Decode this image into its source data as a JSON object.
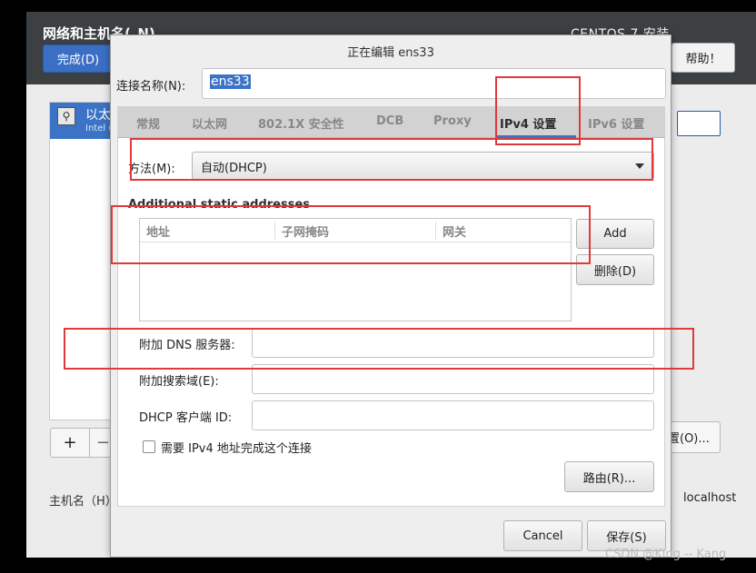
{
  "background": {
    "header_title": "网络和主机名(_N)",
    "header_right": "CENTOS 7 安装",
    "done_button": "完成(D)",
    "help_button": "帮助！",
    "list_item_label": "以太",
    "list_item_sub": "Intel (",
    "plus_label": "+",
    "minus_label": "−",
    "configure_button": "置(O)...",
    "hostname_label": "主机名（H）",
    "hostname_value": "localhost"
  },
  "dialog": {
    "title": "正在编辑 ens33",
    "connection_name_label": "连接名称(N):",
    "connection_name_value": "ens33",
    "tabs": [
      {
        "label": "常规",
        "active": false
      },
      {
        "label": "以太网",
        "active": false
      },
      {
        "label": "802.1X 安全性",
        "active": false
      },
      {
        "label": "DCB",
        "active": false
      },
      {
        "label": "Proxy",
        "active": false
      },
      {
        "label": "IPv4 设置",
        "active": true
      },
      {
        "label": "IPv6 设置",
        "active": false
      }
    ],
    "method_label": "方法(M):",
    "method_value": "自动(DHCP)",
    "static_heading": "Additional static addresses",
    "address_columns": [
      "地址",
      "子网掩码",
      "网关"
    ],
    "add_button": "Add",
    "delete_button": "删除(D)",
    "dns_label": "附加 DNS 服务器:",
    "search_domain_label": "附加搜索域(E):",
    "dhcp_client_id_label": "DHCP 客户端 ID:",
    "require_ipv4_label": "需要 IPv4 地址完成这个连接",
    "require_ipv4_checked": false,
    "routes_button": "路由(R)...",
    "cancel_button": "Cancel",
    "save_button": "保存(S)"
  },
  "watermark": "CSDN @King -- Kang",
  "colors": {
    "accent": "#3b73c6",
    "highlight_box": "#e0393a"
  }
}
